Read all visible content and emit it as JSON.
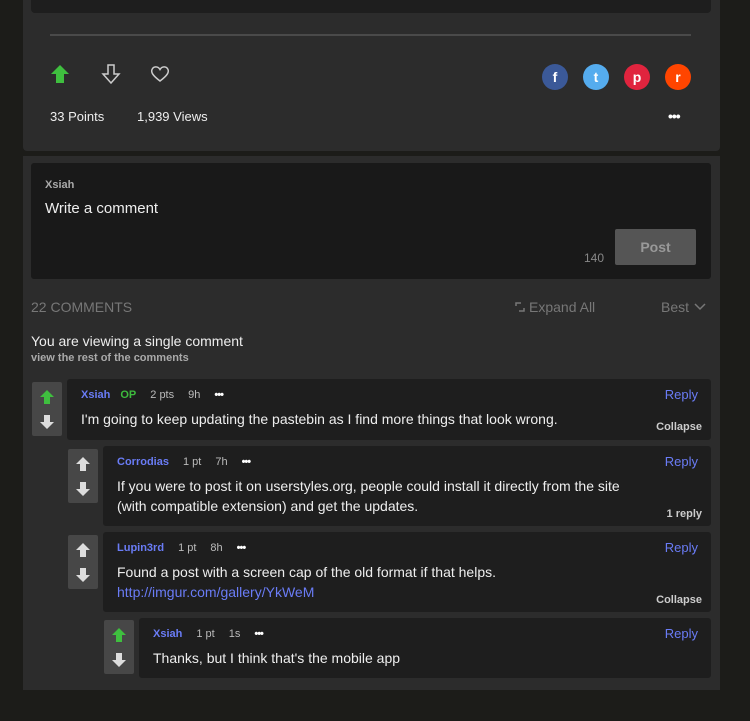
{
  "post": {
    "points": "33 Points",
    "views": "1,939 Views",
    "share": [
      {
        "name": "facebook",
        "glyph": "f",
        "color": "#3b5998"
      },
      {
        "name": "twitter",
        "glyph": "t",
        "color": "#55acee"
      },
      {
        "name": "pinterest",
        "glyph": "p",
        "color": "#e0243e"
      },
      {
        "name": "reddit",
        "glyph": "r",
        "color": "#ff4500"
      }
    ],
    "more": "•••"
  },
  "composer": {
    "user": "Xsiah",
    "placeholder": "Write a comment",
    "char_count": "140",
    "post_label": "Post"
  },
  "comments_header": {
    "count": "22 COMMENTS",
    "expand_all": "Expand All",
    "sort": "Best"
  },
  "single_notice": {
    "title": "You are viewing a single comment",
    "link": "view the rest of the comments"
  },
  "comments": [
    {
      "user": "Xsiah",
      "op": "OP",
      "points": "2 pts",
      "time": "9h",
      "more": "•••",
      "text": "I'm going to keep updating the pastebin as I find more things that look wrong.",
      "reply": "Reply",
      "footer": "Collapse",
      "upvoted": true
    },
    {
      "user": "Corrodias",
      "points": "1 pt",
      "time": "7h",
      "more": "•••",
      "text": "If you were to post it on userstyles.org, people could install it directly from the site (with compatible extension) and get the updates.",
      "reply": "Reply",
      "footer": "1 reply",
      "upvoted": false
    },
    {
      "user": "Lupin3rd",
      "points": "1 pt",
      "time": "8h",
      "more": "•••",
      "text": "Found a post with a screen cap of the old format if that helps.",
      "link": "http://imgur.com/gallery/YkWeM",
      "reply": "Reply",
      "footer": "Collapse",
      "upvoted": false
    },
    {
      "user": "Xsiah",
      "points": "1 pt",
      "time": "1s",
      "more": "•••",
      "text": "Thanks, but I think that's the mobile app",
      "reply": "Reply",
      "upvoted": true
    }
  ]
}
